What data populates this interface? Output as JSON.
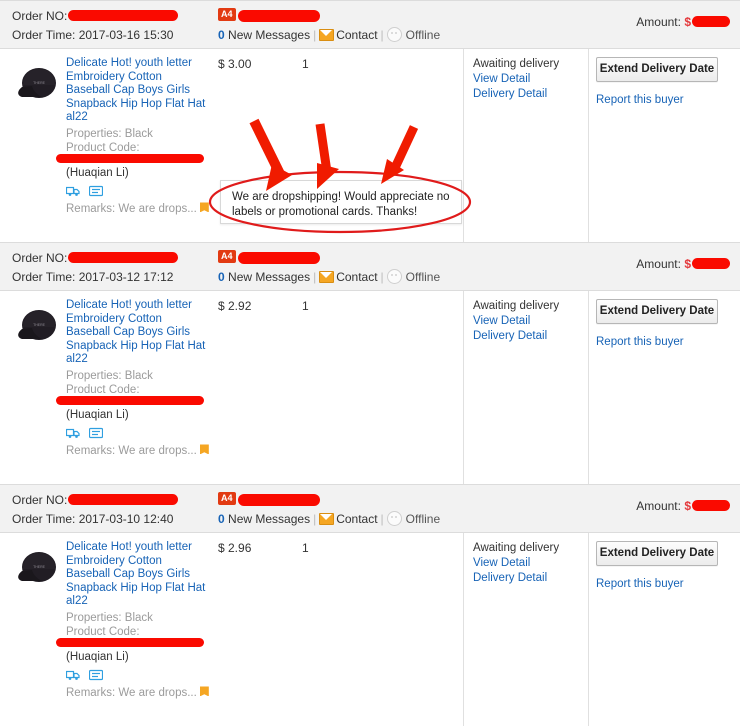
{
  "header_common": {
    "order_no_label": "Order NO:",
    "order_time_label": "Order Time:",
    "badge": "A4",
    "messages_count": "0",
    "messages_label": "New Messages",
    "contact_label": "Contact",
    "offline_label": "Offline",
    "amount_label": "Amount:",
    "amount_currency": "$",
    "separator": "|"
  },
  "product_common": {
    "title": "Delicate Hot! youth letter Embroidery Cotton Baseball Cap Boys Girls Snapback Hip Hop Flat Hat al22",
    "properties": "Properties: Black",
    "product_code": "Product Code:",
    "buyer": "(Huaqian Li)",
    "remarks": "Remarks: We are drops...",
    "shipping_icon_name": "shipping-truck-icon",
    "note_icon_name": "buyer-note-icon",
    "flag_icon_name": "orange-flag-icon"
  },
  "status_common": {
    "status": "Awaiting delivery",
    "view_detail": "View Detail",
    "delivery_detail": "Delivery Detail"
  },
  "actions_common": {
    "extend_button": "Extend Delivery Date",
    "report_link": "Report this buyer"
  },
  "orders": [
    {
      "order_time": "2017-03-16 15:30",
      "price": "$ 3.00",
      "qty": "1"
    },
    {
      "order_time": "2017-03-12 17:12",
      "price": "$ 2.92",
      "qty": "1"
    },
    {
      "order_time": "2017-03-10 12:40",
      "price": "$ 2.96",
      "qty": "1"
    }
  ],
  "annotation": {
    "callout_text": "We are dropshipping! Would appreciate no labels or promotional cards. Thanks!",
    "marker_color": "#e01b1b",
    "arrow_count": "3",
    "ellipse_name": "red-ellipse-highlight"
  },
  "colors": {
    "link": "#1763b6",
    "redaction": "#fa0a00",
    "header_bg": "#f2f2f2",
    "badge_bg": "#e23a12",
    "flag": "#f5a623"
  }
}
